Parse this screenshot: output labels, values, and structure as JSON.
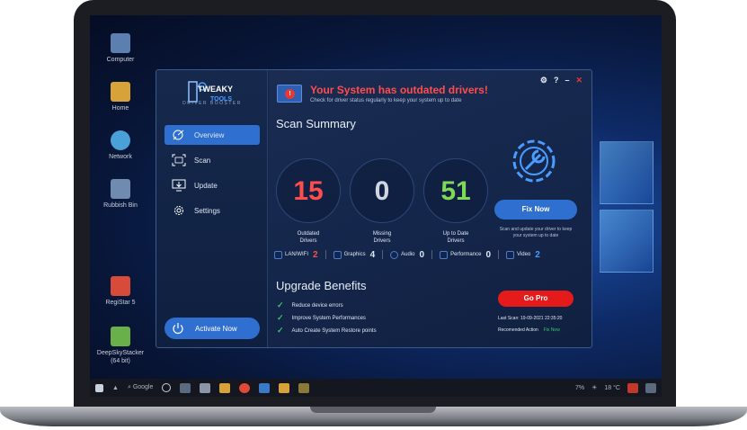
{
  "desktop": {
    "icons": [
      {
        "label": "Computer",
        "color": "#5c7fb0"
      },
      {
        "label": "Home",
        "color": "#d8a23a"
      },
      {
        "label": "Network",
        "color": "#4aa0d8"
      },
      {
        "label": "Rubbish Bin",
        "color": "#6f8bb0"
      },
      {
        "label": "RegiStar 5",
        "color": "#d84a3a"
      },
      {
        "label": "DeepSkyStacker (64 bit)",
        "color": "#6ab04a"
      }
    ],
    "taskbar": {
      "search_label": "Google",
      "tray_percent": "7%",
      "tray_temp": "18 °C"
    }
  },
  "app": {
    "logo_line1": "TWEAKY",
    "logo_line2": "TOOLS",
    "logo_caption": "DRIVER BOOSTER",
    "nav": [
      {
        "label": "Overview",
        "icon": "overview-icon",
        "active": true
      },
      {
        "label": "Scan",
        "icon": "scan-icon",
        "active": false
      },
      {
        "label": "Update",
        "icon": "update-icon",
        "active": false
      },
      {
        "label": "Settings",
        "icon": "settings-gear-icon",
        "active": false
      }
    ],
    "activate_label": "Activate Now",
    "window_controls": {
      "settings": "⚙",
      "help": "?",
      "minimize": "–",
      "close": "✕"
    },
    "alert": {
      "title": "Your System has outdated drivers!",
      "subtitle": "Check for driver status regularly to keep your system up to date"
    },
    "scan_summary": {
      "title": "Scan Summary",
      "stats": [
        {
          "value": "15",
          "label_line1": "Outdated",
          "label_line2": "Drivers",
          "color": "#ff4d4d"
        },
        {
          "value": "0",
          "label_line1": "Missing",
          "label_line2": "Drivers",
          "color": "#cfd6e2"
        },
        {
          "value": "51",
          "label_line1": "Up to Date",
          "label_line2": "Drivers",
          "color": "#7ed957"
        }
      ],
      "fix_now_label": "Fix Now",
      "fix_note_line1": "Scan and update your driver to keep",
      "fix_note_line2": "your system up to date"
    },
    "categories": [
      {
        "label": "LAN/WIFI",
        "value": "2",
        "color": "#ff4d4d"
      },
      {
        "label": "Graphics",
        "value": "4",
        "color": "#e8eef7"
      },
      {
        "label": "Audio",
        "value": "0",
        "color": "#e8eef7"
      },
      {
        "label": "Performance",
        "value": "0",
        "color": "#e8eef7"
      },
      {
        "label": "Video",
        "value": "2",
        "color": "#4a9cff"
      }
    ],
    "upgrade": {
      "title": "Upgrade Benefits",
      "benefits": [
        "Reduce device errors",
        "Improve System Performances",
        "Auto Create System Restore points"
      ],
      "go_pro_label": "Go Pro",
      "last_scan": "Last Scan: 19-09-2021 22:35:20",
      "recommended_label": "Recomended Action",
      "recommended_action": "Fix Now"
    }
  },
  "colors": {
    "accent": "#2f6fcf",
    "danger": "#e51b1b",
    "success": "#3ac66a"
  }
}
